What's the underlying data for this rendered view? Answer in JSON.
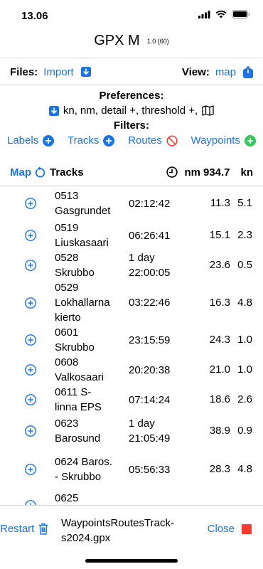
{
  "status_bar": {
    "time": "13.06"
  },
  "header": {
    "title": "GPX M",
    "version": "1.0 (60)"
  },
  "files_row": {
    "files_label": "Files:",
    "import_label": "Import",
    "view_label": "View:",
    "view_value": "map"
  },
  "preferences": {
    "label": "Preferences:",
    "summary": "kn, nm, detail +, threshold +,"
  },
  "filters": {
    "label": "Filters:",
    "items": [
      {
        "label": "Labels",
        "icon": "plus-circle-icon"
      },
      {
        "label": "Tracks",
        "icon": "plus-circle-icon"
      },
      {
        "label": "Routes",
        "icon": "no-symbol-icon"
      },
      {
        "label": "Waypoints",
        "icon": "plus-circle-green-icon"
      }
    ]
  },
  "tracks_header": {
    "map_label": "Map",
    "tracks_label": "Tracks",
    "distance_unit": "nm",
    "total_distance": "934.7",
    "speed_unit": "kn"
  },
  "tracks": [
    {
      "name_lines": [
        "0513",
        "Gasgrundet"
      ],
      "duration_lines": [
        "02:12:42"
      ],
      "distance": "11.3",
      "speed": "5.1"
    },
    {
      "name_lines": [
        "0519",
        "Liuskasaari"
      ],
      "duration_lines": [
        "06:26:41"
      ],
      "distance": "15.1",
      "speed": "2.3"
    },
    {
      "name_lines": [
        "0528",
        "Skrubbo"
      ],
      "duration_lines": [
        "1 day",
        "22:00:05"
      ],
      "distance": "23.6",
      "speed": "0.5"
    },
    {
      "name_lines": [
        "0529",
        "Lokhallarna",
        "kierto"
      ],
      "duration_lines": [
        "03:22:46"
      ],
      "distance": "16.3",
      "speed": "4.8"
    },
    {
      "name_lines": [
        "0601",
        "Skrubbo"
      ],
      "duration_lines": [
        "23:15:59"
      ],
      "distance": "24.3",
      "speed": "1.0"
    },
    {
      "name_lines": [
        "0608",
        "Valkosaari"
      ],
      "duration_lines": [
        "20:20:38"
      ],
      "distance": "21.0",
      "speed": "1.0"
    },
    {
      "name_lines": [
        "0611 S-",
        "linna EPS"
      ],
      "duration_lines": [
        "07:14:24"
      ],
      "distance": "18.6",
      "speed": "2.6"
    },
    {
      "name_lines": [
        "0623",
        "Barosund"
      ],
      "duration_lines": [
        "1 day",
        "21:05:49"
      ],
      "distance": "38.9",
      "speed": "0.9"
    },
    {
      "name_lines": [
        "0624 Baros.",
        "- Skrubbo"
      ],
      "duration_lines": [
        "05:56:33"
      ],
      "distance": "28.3",
      "speed": "4.8"
    },
    {
      "name_lines": [
        "0625",
        ""
      ],
      "duration_lines": [
        ""
      ],
      "distance": "",
      "speed": ""
    }
  ],
  "bottom_bar": {
    "restart_label": "Restart",
    "file_name_lines": [
      "WaypointsRoutesTrack-",
      "s2024.gpx"
    ],
    "close_label": "Close"
  },
  "colors": {
    "accent": "#1a73e8",
    "green": "#34c759",
    "red": "#ff3b30",
    "stop_red": "#ff3b30"
  }
}
